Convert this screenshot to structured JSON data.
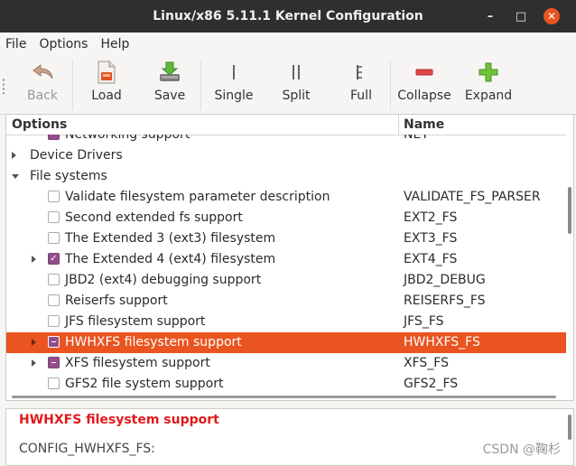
{
  "window": {
    "title": "Linux/x86 5.11.1 Kernel Configuration",
    "controls": {
      "minimize": "–",
      "maximize": "□",
      "close": "✕"
    }
  },
  "menu": [
    "File",
    "Options",
    "Help"
  ],
  "toolbar": {
    "back": "Back",
    "load": "Load",
    "save": "Save",
    "single": "Single",
    "split": "Split",
    "full": "Full",
    "collapse": "Collapse",
    "expand": "Expand"
  },
  "tree": {
    "headers": {
      "options": "Options",
      "name": "Name"
    },
    "rows": [
      {
        "label": "Networking support",
        "name": "NET",
        "expander": "none",
        "check": "module",
        "indent": 1
      },
      {
        "label": "Device Drivers",
        "name": "",
        "expander": "collapsed",
        "check": "none",
        "indent": 0
      },
      {
        "label": "File systems",
        "name": "",
        "expander": "expanded",
        "check": "none",
        "indent": 0
      },
      {
        "label": "Validate filesystem parameter description",
        "name": "VALIDATE_FS_PARSER",
        "expander": "none",
        "check": "unchecked",
        "indent": 1
      },
      {
        "label": "Second extended fs support",
        "name": "EXT2_FS",
        "expander": "none",
        "check": "unchecked",
        "indent": 1
      },
      {
        "label": "The Extended 3 (ext3) filesystem",
        "name": "EXT3_FS",
        "expander": "none",
        "check": "unchecked",
        "indent": 1
      },
      {
        "label": "The Extended 4 (ext4) filesystem",
        "name": "EXT4_FS",
        "expander": "collapsed",
        "check": "checked",
        "indent": 1
      },
      {
        "label": "JBD2 (ext4) debugging support",
        "name": "JBD2_DEBUG",
        "expander": "none",
        "check": "unchecked",
        "indent": 1
      },
      {
        "label": "Reiserfs support",
        "name": "REISERFS_FS",
        "expander": "none",
        "check": "unchecked",
        "indent": 1
      },
      {
        "label": "JFS filesystem support",
        "name": "JFS_FS",
        "expander": "none",
        "check": "unchecked",
        "indent": 1
      },
      {
        "label": "HWHXFS filesystem support",
        "name": "HWHXFS_FS",
        "expander": "collapsed",
        "check": "module",
        "indent": 1,
        "selected": true
      },
      {
        "label": "XFS filesystem support",
        "name": "XFS_FS",
        "expander": "collapsed",
        "check": "module",
        "indent": 1
      },
      {
        "label": "GFS2 file system support",
        "name": "GFS2_FS",
        "expander": "none",
        "check": "unchecked",
        "indent": 1
      }
    ]
  },
  "help": {
    "title": "HWHXFS filesystem support",
    "config": "CONFIG_HWHXFS_FS:"
  },
  "watermark": "CSDN @鞠杉",
  "colors": {
    "selection": "#e95420",
    "checkbox": "#924d8b",
    "help_title": "#e01b1b"
  }
}
